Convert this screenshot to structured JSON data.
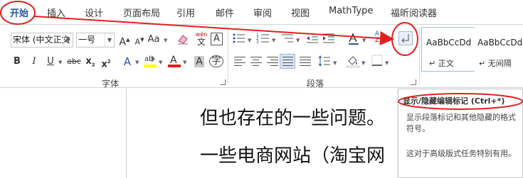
{
  "tabs": [
    "开始",
    "插入",
    "设计",
    "页面布局",
    "引用",
    "邮件",
    "审阅",
    "视图",
    "MathType",
    "福昕阅读器"
  ],
  "ribbon": {
    "font_group_label": "字体",
    "paragraph_group_label": "段落",
    "font_name": "宋体 (中文正文",
    "font_size": "一号",
    "wen_label": "wén",
    "styles": [
      {
        "sample": "AaBbCcDd",
        "name": "正文"
      },
      {
        "sample": "AaBbCcDd",
        "name": "无间隔"
      }
    ]
  },
  "document": {
    "line1": "但也存在的一些问题。",
    "line2": "一些电商网站（淘宝网"
  },
  "tooltip": {
    "title": "显示/隐藏编辑标记 (Ctrl+*)",
    "description": "显示段落标记和其他隐藏的格式符号。",
    "note": "这对于高级版式任务特别有用。"
  },
  "colors": {
    "accent": "#2b579a",
    "annotation": "#e02020",
    "highlight": "#ffff00",
    "font_color": "#e02020"
  }
}
